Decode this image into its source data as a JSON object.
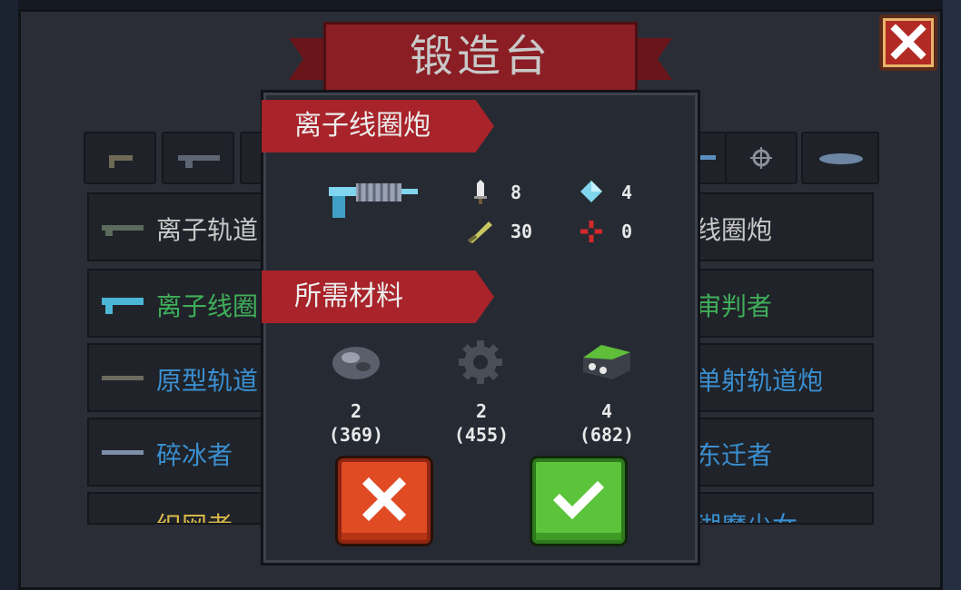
{
  "title": "锻造台",
  "list": {
    "left_rows": [
      {
        "label": "离子轨道",
        "color": "#c8c8c8"
      },
      {
        "label": "离子线圈",
        "color": "#3fae5a"
      },
      {
        "label": "原型轨道",
        "color": "#3a8fd0"
      },
      {
        "label": "碎冰者",
        "color": "#3a8fd0"
      },
      {
        "label": "织网者",
        "color": "#d8b84a"
      }
    ],
    "right_rows": [
      {
        "label": "线圈炮",
        "color": "#c8c8c8"
      },
      {
        "label": "审判者",
        "color": "#3fae5a"
      },
      {
        "label": "单射轨道炮",
        "color": "#3a8fd0"
      },
      {
        "label": "东迁者",
        "color": "#3a8fd0"
      },
      {
        "label": "湖魔少女",
        "color": "#3a8fd0"
      }
    ]
  },
  "dialog": {
    "weapon_name": "离子线圈炮",
    "stats": {
      "attack": "8",
      "energy": "4",
      "accuracy": "30",
      "critical": "0"
    },
    "materials_title": "所需材料",
    "materials": [
      {
        "icon": "ore-icon",
        "need": "2",
        "have": "(369)"
      },
      {
        "icon": "gear-part-icon",
        "need": "2",
        "have": "(455)"
      },
      {
        "icon": "battery-part-icon",
        "need": "4",
        "have": "(682)"
      }
    ]
  },
  "colors": {
    "banner": "#8a1e24",
    "cancel": "#e04b24",
    "confirm": "#5cc43a"
  }
}
